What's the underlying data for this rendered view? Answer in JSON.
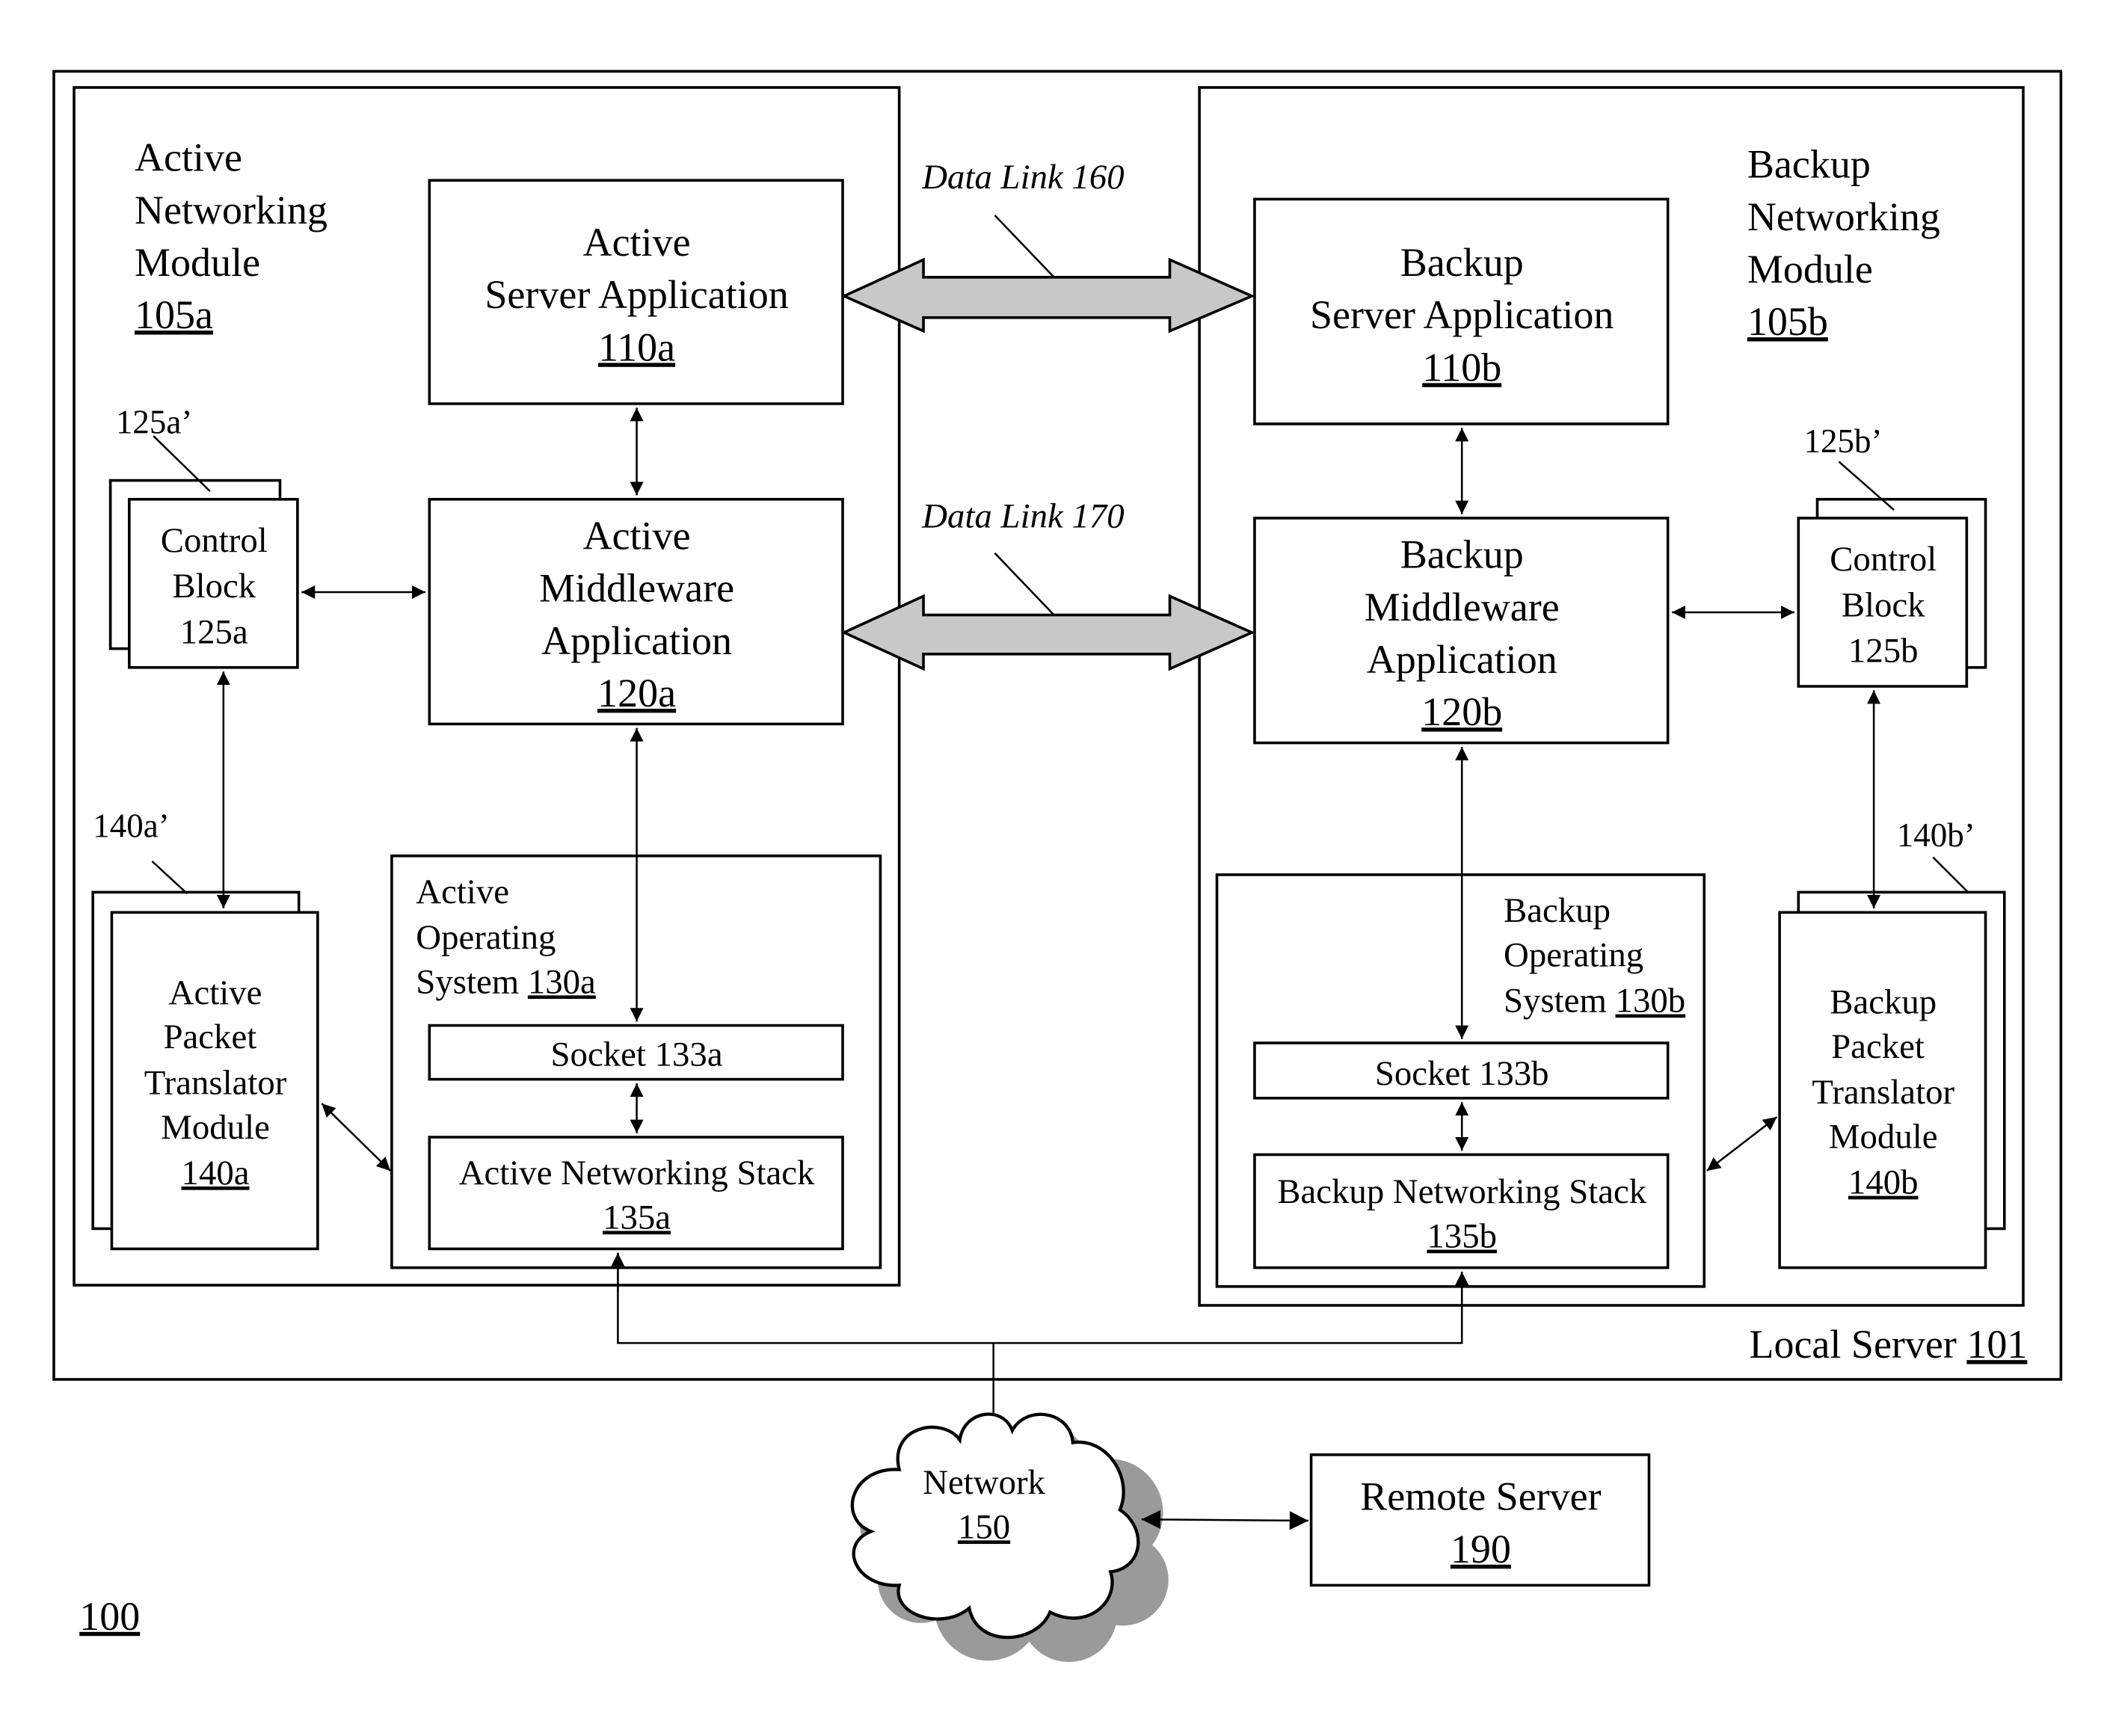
{
  "figure": {
    "reference": "100",
    "local_server": {
      "label": "Local Server",
      "ref": "101"
    },
    "active_module": {
      "lines": [
        "Active",
        "Networking",
        "Module"
      ],
      "ref": "105a",
      "server_app": {
        "lines": [
          "Active",
          "Server Application"
        ],
        "ref": "110a"
      },
      "middleware": {
        "lines": [
          "Active",
          "Middleware",
          "Application"
        ],
        "ref": "120a"
      },
      "control_block": {
        "lines": [
          "Control",
          "Block",
          "125a"
        ],
        "copy_ref": "125a’"
      },
      "packet_translator": {
        "lines": [
          "Active",
          "Packet",
          "Translator",
          "Module"
        ],
        "ref": "140a",
        "copy_ref": "140a’"
      },
      "os": {
        "lines": [
          "Active",
          "Operating",
          "System "
        ],
        "ref": "130a"
      },
      "socket": {
        "label": "Socket 133a"
      },
      "stack": {
        "label": "Active Networking Stack",
        "ref": "135a"
      }
    },
    "backup_module": {
      "lines": [
        "Backup",
        "Networking",
        "Module"
      ],
      "ref": "105b",
      "server_app": {
        "lines": [
          "Backup",
          "Server Application"
        ],
        "ref": "110b"
      },
      "middleware": {
        "lines": [
          "Backup",
          "Middleware",
          "Application"
        ],
        "ref": "120b"
      },
      "control_block": {
        "lines": [
          "Control",
          "Block",
          "125b"
        ],
        "copy_ref": "125b’"
      },
      "packet_translator": {
        "lines": [
          "Backup",
          "Packet",
          "Translator",
          "Module"
        ],
        "ref": "140b",
        "copy_ref": "140b’"
      },
      "os": {
        "lines": [
          "Backup",
          "Operating",
          "System "
        ],
        "ref": "130b"
      },
      "socket": {
        "label": "Socket 133b"
      },
      "stack": {
        "label": "Backup Networking Stack",
        "ref": "135b"
      }
    },
    "data_links": [
      {
        "label": "Data Link 160"
      },
      {
        "label": "Data Link 170"
      }
    ],
    "network": {
      "label": "Network",
      "ref": "150"
    },
    "remote_server": {
      "label": "Remote Server",
      "ref": "190"
    },
    "colors": {
      "line": "#000000",
      "link_fill": "#c8c8c8",
      "cloud_shadow": "#9a9a9a",
      "background": "#ffffff"
    }
  }
}
